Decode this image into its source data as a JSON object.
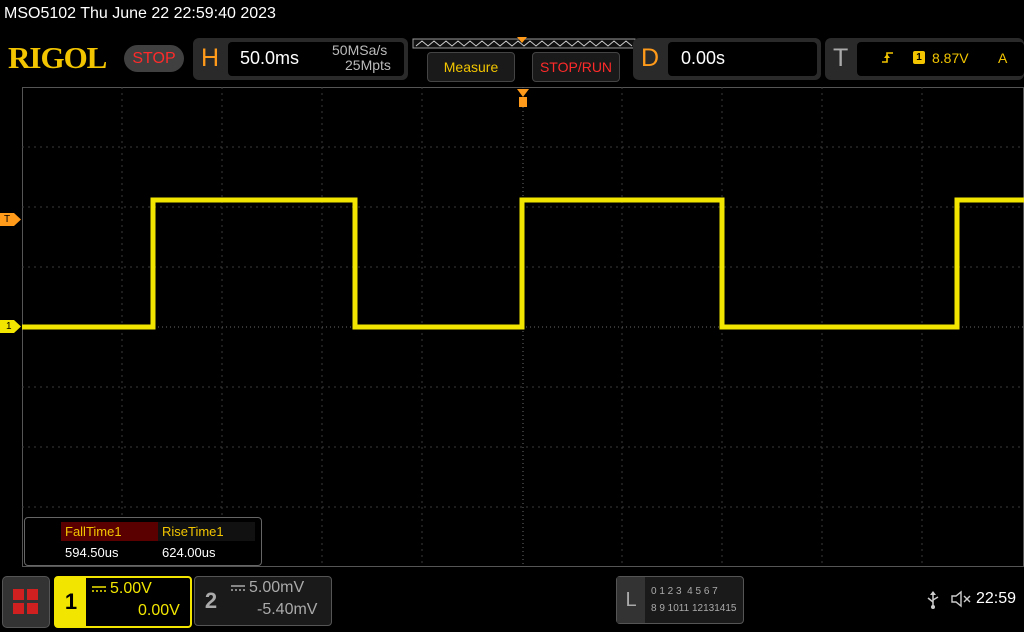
{
  "status_line": "MSO5102  Thu June 22 22:59:40 2023",
  "brand": "RIGOL",
  "run_state": "STOP",
  "horizontal": {
    "letter": "H",
    "timebase": "50.0ms",
    "sample_rate": "50MSa/s",
    "memory_depth": "25Mpts"
  },
  "buttons": {
    "measure": "Measure",
    "stop_run": "STOP/RUN"
  },
  "delay": {
    "letter": "D",
    "value": "0.00s"
  },
  "trigger": {
    "letter": "T",
    "channel": "1",
    "level": "8.87V",
    "mode": "A"
  },
  "left_markers": {
    "trigger": "T",
    "ch1": "1"
  },
  "measurements": [
    {
      "label": "FallTime1",
      "value": "594.50us"
    },
    {
      "label": "RiseTime1",
      "value": "624.00us"
    }
  ],
  "channels": [
    {
      "number": "1",
      "scale": "5.00V",
      "offset": "0.00V",
      "color": "#f2e600"
    },
    {
      "number": "2",
      "scale": "5.00mV",
      "offset": "-5.40mV",
      "color": "#888888"
    }
  ],
  "logic": {
    "letter": "L",
    "row1": "0 1 2 3  4 5 6 7",
    "row2": "8 9 1011 12131415"
  },
  "clock": "22:59",
  "icons": [
    "menu-icon",
    "usb-icon",
    "mute-icon",
    "trigger-edge-icon"
  ]
}
